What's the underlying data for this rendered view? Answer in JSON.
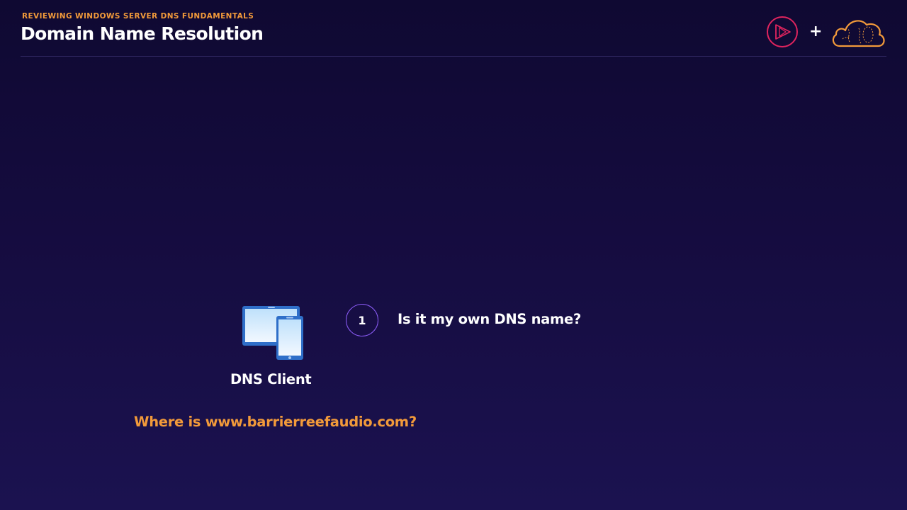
{
  "header": {
    "subtitle": "REVIEWING WINDOWS SERVER DNS FUNDAMENTALS",
    "title": "Domain Name Resolution"
  },
  "logos": {
    "left_icon": "play-logo-icon",
    "separator": "+",
    "right_icon": "cloud-logo-icon"
  },
  "client": {
    "icon": "devices-icon",
    "label": "DNS Client"
  },
  "steps": [
    {
      "number": "1",
      "text": "Is it my own DNS name?"
    }
  ],
  "query": "Where is www.barrierreefaudio.com?",
  "colors": {
    "background_top": "#0f0932",
    "background_bottom": "#1b1250",
    "accent_orange": "#f29a3a",
    "step_circle_purple": "#8b5cf6",
    "play_logo": "#e0245e"
  }
}
